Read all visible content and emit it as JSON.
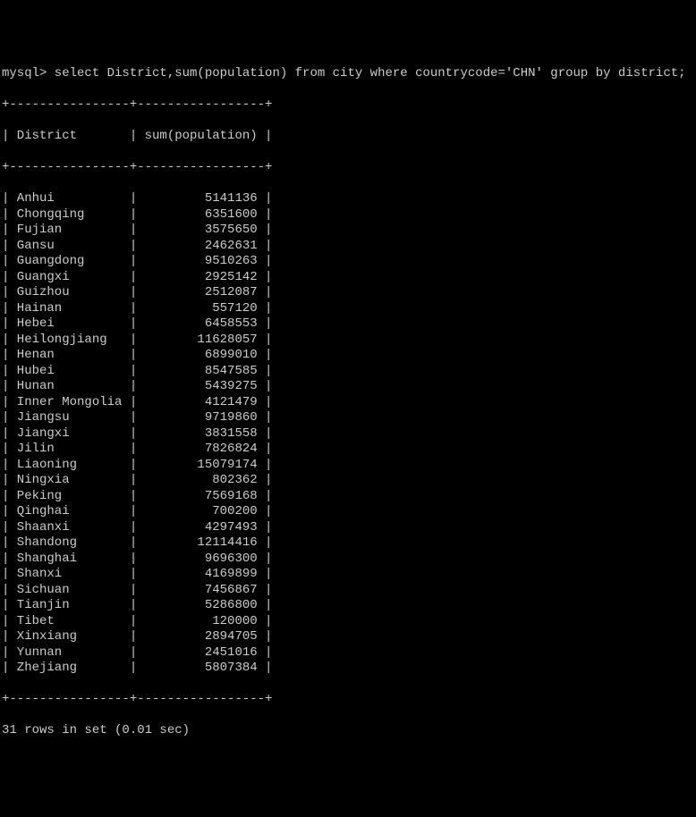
{
  "prompt": "mysql> select District,sum(population) from city where countrycode='CHN' group by district;",
  "border": "+----------------+-----------------+",
  "headerRow": "| District       | sum(population) |",
  "columns": [
    "District",
    "sum(population)"
  ],
  "rows": [
    {
      "district": "Anhui",
      "pop": "5141136"
    },
    {
      "district": "Chongqing",
      "pop": "6351600"
    },
    {
      "district": "Fujian",
      "pop": "3575650"
    },
    {
      "district": "Gansu",
      "pop": "2462631"
    },
    {
      "district": "Guangdong",
      "pop": "9510263"
    },
    {
      "district": "Guangxi",
      "pop": "2925142"
    },
    {
      "district": "Guizhou",
      "pop": "2512087"
    },
    {
      "district": "Hainan",
      "pop": "557120"
    },
    {
      "district": "Hebei",
      "pop": "6458553"
    },
    {
      "district": "Heilongjiang",
      "pop": "11628057"
    },
    {
      "district": "Henan",
      "pop": "6899010"
    },
    {
      "district": "Hubei",
      "pop": "8547585"
    },
    {
      "district": "Hunan",
      "pop": "5439275"
    },
    {
      "district": "Inner Mongolia",
      "pop": "4121479"
    },
    {
      "district": "Jiangsu",
      "pop": "9719860"
    },
    {
      "district": "Jiangxi",
      "pop": "3831558"
    },
    {
      "district": "Jilin",
      "pop": "7826824"
    },
    {
      "district": "Liaoning",
      "pop": "15079174"
    },
    {
      "district": "Ningxia",
      "pop": "802362"
    },
    {
      "district": "Peking",
      "pop": "7569168"
    },
    {
      "district": "Qinghai",
      "pop": "700200"
    },
    {
      "district": "Shaanxi",
      "pop": "4297493"
    },
    {
      "district": "Shandong",
      "pop": "12114416"
    },
    {
      "district": "Shanghai",
      "pop": "9696300"
    },
    {
      "district": "Shanxi",
      "pop": "4169899"
    },
    {
      "district": "Sichuan",
      "pop": "7456867"
    },
    {
      "district": "Tianjin",
      "pop": "5286800"
    },
    {
      "district": "Tibet",
      "pop": "120000"
    },
    {
      "district": "Xinxiang",
      "pop": "2894705"
    },
    {
      "district": "Yunnan",
      "pop": "2451016"
    },
    {
      "district": "Zhejiang",
      "pop": "5807384"
    }
  ],
  "footer": "31 rows in set (0.01 sec)",
  "col1Width": 16,
  "col2Width": 17
}
